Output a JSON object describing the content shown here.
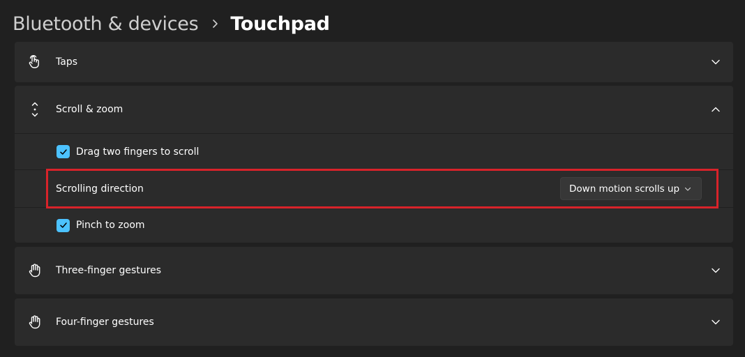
{
  "header": {
    "parent": "Bluetooth & devices",
    "separator_icon": "chevron-right-icon",
    "current": "Touchpad"
  },
  "sections": {
    "taps": {
      "label": "Taps",
      "icon": "tap-gesture-icon",
      "expanded": false
    },
    "scroll_zoom": {
      "label": "Scroll & zoom",
      "icon": "scroll-arrows-icon",
      "expanded": true,
      "drag_two_fingers": {
        "label": "Drag two fingers to scroll",
        "checked": true
      },
      "scrolling_direction": {
        "label": "Scrolling direction",
        "selected": "Down motion scrolls up",
        "highlighted": true
      },
      "pinch_to_zoom": {
        "label": "Pinch to zoom",
        "checked": true
      }
    },
    "three_finger": {
      "label": "Three-finger gestures",
      "icon": "hand-icon",
      "expanded": false
    },
    "four_finger": {
      "label": "Four-finger gestures",
      "icon": "hand-icon",
      "expanded": false
    }
  },
  "colors": {
    "background": "#202020",
    "card": "#2b2b2b",
    "accent": "#4cc2ff",
    "highlight": "#d8232a"
  }
}
